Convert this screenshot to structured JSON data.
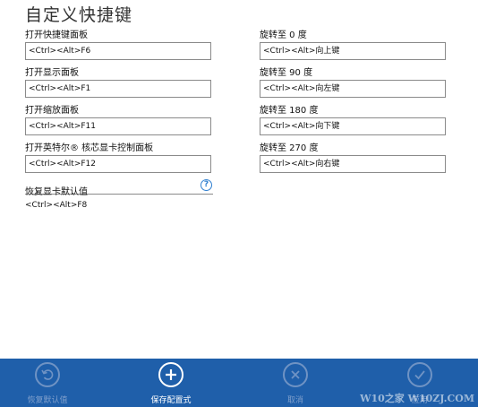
{
  "page_title": "自定义快捷键",
  "left_fields": [
    {
      "label": "打开快捷键面板",
      "value": "<Ctrl><Alt>F6"
    },
    {
      "label": "打开显示面板",
      "value": "<Ctrl><Alt>F1"
    },
    {
      "label": "打开缩放面板",
      "value": "<Ctrl><Alt>F11"
    },
    {
      "label": "打开英特尔® 核芯显卡控制面板",
      "value": "<Ctrl><Alt>F12"
    }
  ],
  "right_fields": [
    {
      "label": "旋转至 0 度",
      "value": "<Ctrl><Alt>向上键"
    },
    {
      "label": "旋转至 90 度",
      "value": "<Ctrl><Alt>向左键"
    },
    {
      "label": "旋转至 180 度",
      "value": "<Ctrl><Alt>向下键"
    },
    {
      "label": "旋转至 270 度",
      "value": "<Ctrl><Alt>向右键"
    }
  ],
  "reset": {
    "label": "恢复显卡默认值",
    "value": "<Ctrl><Alt>F8",
    "help_glyph": "?"
  },
  "appbar": {
    "restore_label": "恢复默认值",
    "save_label": "保存配置式",
    "cancel_label": "取消",
    "apply_label": "应用"
  },
  "watermark": "W10之家 W10ZJ.COM",
  "colors": {
    "appbar_bg": "#1f5faa",
    "accent": "#2f7fd0",
    "disabled": "#7f9fcc"
  },
  "icons": {
    "restore": "undo-icon",
    "save": "plus-icon",
    "cancel": "close-icon",
    "apply": "checkmark-icon",
    "help": "help-icon"
  }
}
